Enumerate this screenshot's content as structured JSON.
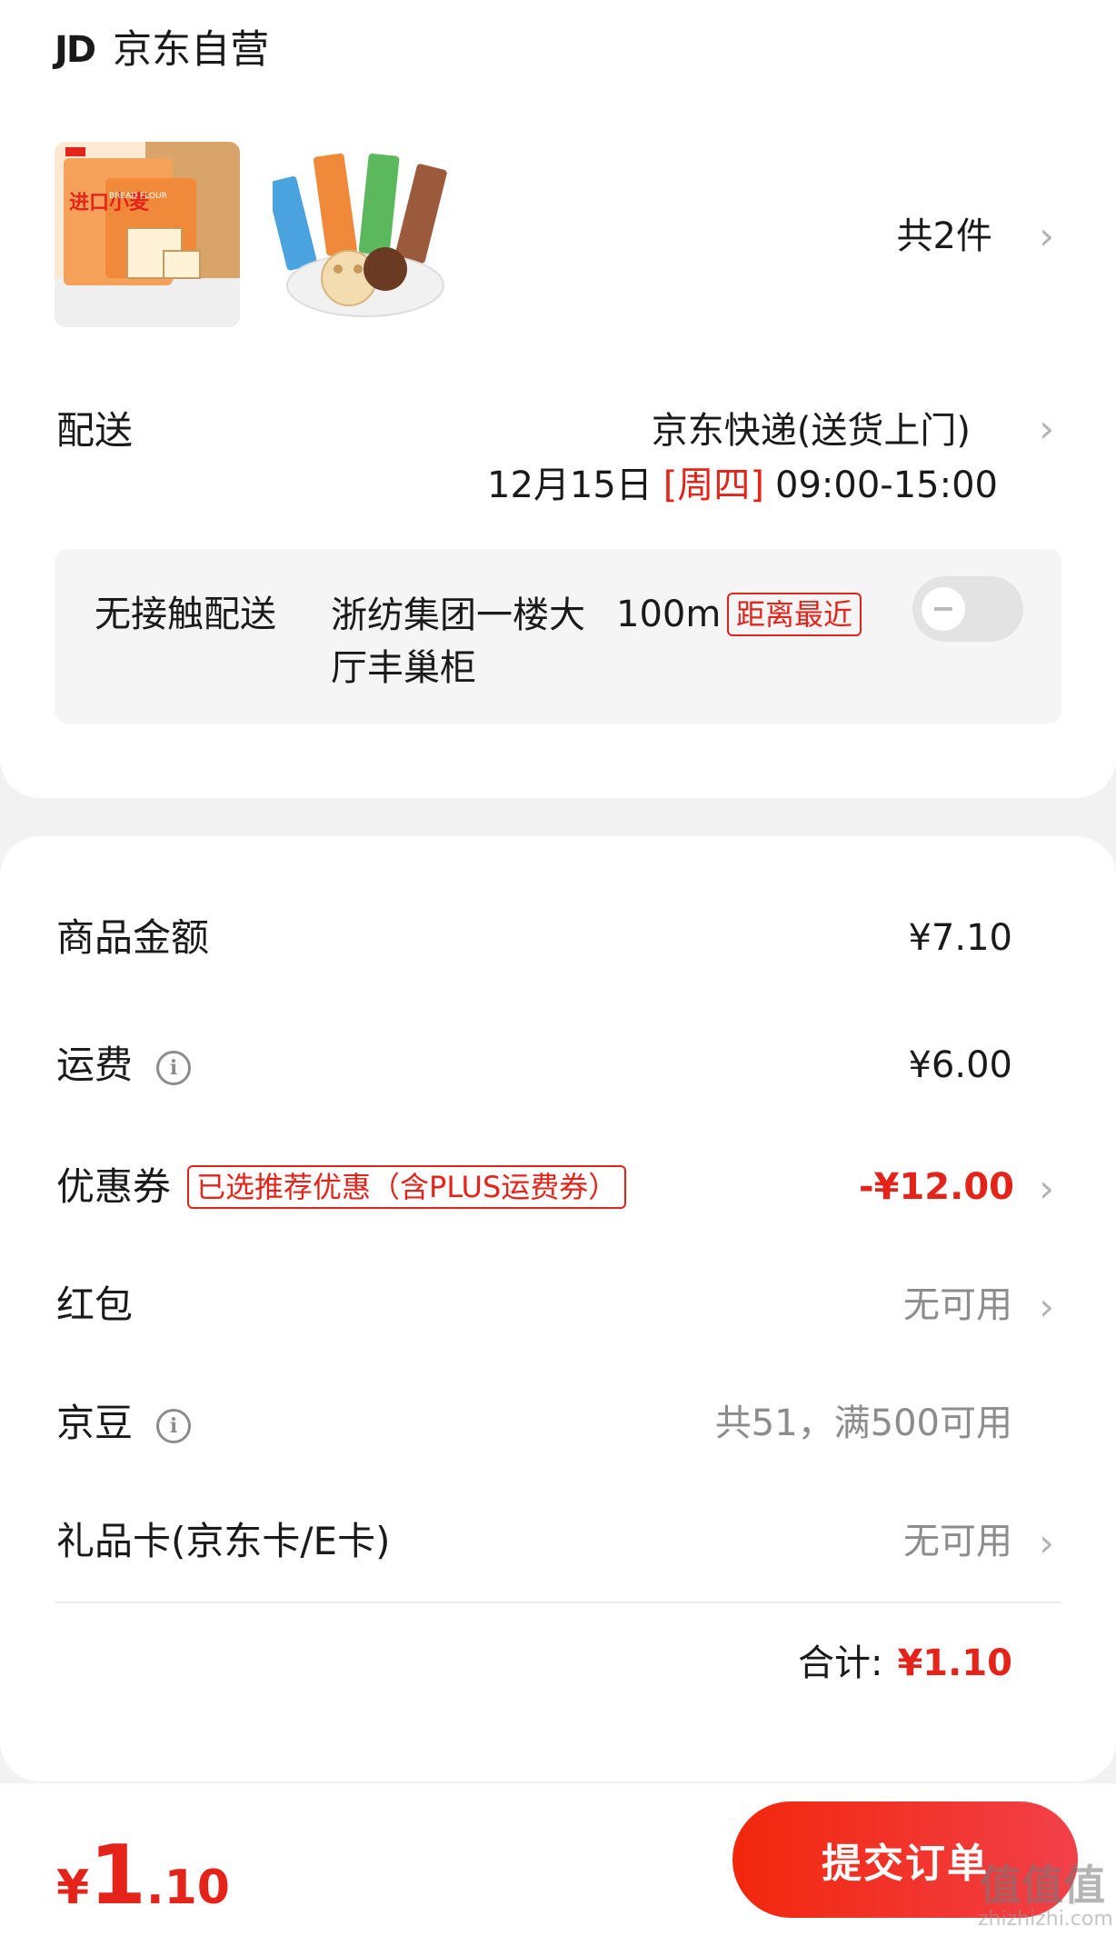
{
  "shop": {
    "logo_text": "JD",
    "name": "京东自营"
  },
  "products": {
    "item1": {
      "badge": "进口小麦",
      "subtitle": "BREAD FLOUR"
    },
    "count_label": "共2件"
  },
  "delivery": {
    "label": "配送",
    "method": "京东快递(送货上门)",
    "date": "12月15日",
    "weekday": "[周四]",
    "time_window": "09:00-15:00"
  },
  "contactless": {
    "label": "无接触配送",
    "location": "浙纺集团一楼大厅丰巢柜",
    "distance": "100m",
    "tag": "距离最近",
    "enabled": false
  },
  "summary": {
    "goods_label": "商品金额",
    "goods_value": "¥7.10",
    "shipping_label": "运费",
    "shipping_value": "¥6.00",
    "coupon_label": "优惠券",
    "coupon_tag": "已选推荐优惠（含PLUS运费券）",
    "coupon_value": "-¥12.00",
    "redpacket_label": "红包",
    "redpacket_value": "无可用",
    "jingdou_label": "京豆",
    "jingdou_value": "共51，满500可用",
    "giftcard_label": "礼品卡(京东卡/E卡)",
    "giftcard_value": "无可用",
    "total_label": "合计:",
    "total_value": "¥1.10"
  },
  "footer": {
    "price_currency": "¥",
    "price_int": "1",
    "price_dec": ".10",
    "submit_label": "提交订单"
  },
  "watermark": {
    "text": "值值值",
    "sub": "zhizhizhi.com"
  },
  "colors": {
    "accent": "#e4241a",
    "submit": "#f2270c"
  },
  "icons": {
    "chevron": "chevron-right-icon",
    "info": "info-icon"
  }
}
